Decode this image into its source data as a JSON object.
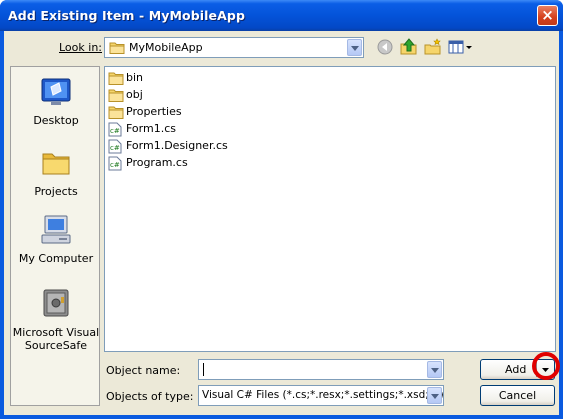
{
  "window": {
    "title": "Add Existing Item - MyMobileApp",
    "close_label": "×"
  },
  "toolbar": {
    "lookin_label": "Look in:",
    "lookin_value": "MyMobileApp",
    "icons": [
      "back-icon",
      "up-folder-icon",
      "new-folder-icon",
      "views-menu-icon"
    ]
  },
  "places": [
    {
      "label": "Desktop",
      "icon": "desktop-icon"
    },
    {
      "label": "Projects",
      "icon": "folder-icon"
    },
    {
      "label": "My Computer",
      "icon": "computer-icon"
    },
    {
      "label": "Microsoft Visual SourceSafe",
      "icon": "sourcesafe-icon"
    }
  ],
  "files": [
    {
      "name": "bin",
      "type": "folder"
    },
    {
      "name": "obj",
      "type": "folder"
    },
    {
      "name": "Properties",
      "type": "folder"
    },
    {
      "name": "Form1.cs",
      "type": "cs-file"
    },
    {
      "name": "Form1.Designer.cs",
      "type": "cs-file"
    },
    {
      "name": "Program.cs",
      "type": "cs-file"
    }
  ],
  "bottom": {
    "object_name_label": "Object name:",
    "object_name_value": "",
    "object_type_label": "Objects of type:",
    "object_type_value": "Visual C# Files (*.cs;*.resx;*.settings;*.xsd;*.wsc",
    "add_label": "Add",
    "cancel_label": "Cancel"
  },
  "colors": {
    "highlight_circle": "#e00000",
    "title_bar": "#0453d9"
  }
}
